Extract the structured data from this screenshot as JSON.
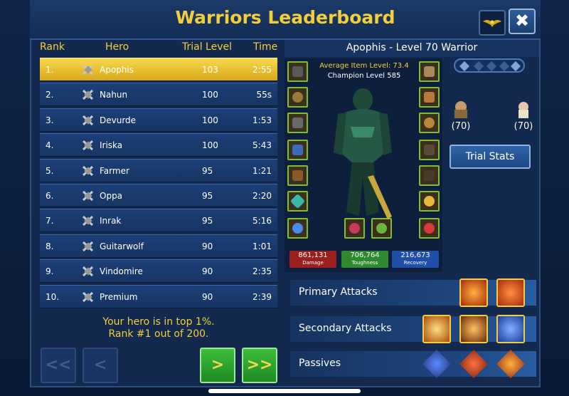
{
  "title": "Warriors Leaderboard",
  "close_label": "✖",
  "columns": {
    "rank": "Rank",
    "hero": "Hero",
    "level": "Trial Level",
    "time": "Time"
  },
  "rows": [
    {
      "rank": "1.",
      "hero": "Apophis",
      "level": "103",
      "time": "2:55"
    },
    {
      "rank": "2.",
      "hero": "Nahun",
      "level": "100",
      "time": "55s"
    },
    {
      "rank": "3.",
      "hero": "Devurde",
      "level": "100",
      "time": "1:53"
    },
    {
      "rank": "4.",
      "hero": "Iriska",
      "level": "100",
      "time": "5:43"
    },
    {
      "rank": "5.",
      "hero": "Farmer",
      "level": "95",
      "time": "1:21"
    },
    {
      "rank": "6.",
      "hero": "Oppa",
      "level": "95",
      "time": "2:20"
    },
    {
      "rank": "7.",
      "hero": "Inrak",
      "level": "95",
      "time": "5:16"
    },
    {
      "rank": "8.",
      "hero": "Guitarwolf",
      "level": "90",
      "time": "1:01"
    },
    {
      "rank": "9.",
      "hero": "Vindomire",
      "level": "90",
      "time": "2:35"
    },
    {
      "rank": "10.",
      "hero": "Premium",
      "level": "90",
      "time": "2:39"
    }
  ],
  "info_line1": "Your hero is in top 1%.",
  "info_line2": "Rank #1 out of 200.",
  "nav": {
    "first": "<<",
    "prev": "<",
    "next": ">",
    "last": ">>"
  },
  "hero_title": "Apophis - Level 70 Warrior",
  "avg_item_level": "Average Item Level: 73.4",
  "champion_level": "Champion Level 585",
  "stats": [
    {
      "value": "861,131",
      "label": "Damage",
      "color": "#9b1f1f"
    },
    {
      "value": "706,764",
      "label": "Toughness",
      "color": "#2f8a2f"
    },
    {
      "value": "216,673",
      "label": "Recovery",
      "color": "#1f4fa8"
    }
  ],
  "allies": [
    {
      "level": "(70)"
    },
    {
      "level": "(70)"
    }
  ],
  "trial_stats_label": "Trial Stats",
  "abilities": {
    "primary": "Primary Attacks",
    "secondary": "Secondary Attacks",
    "passives": "Passives"
  }
}
